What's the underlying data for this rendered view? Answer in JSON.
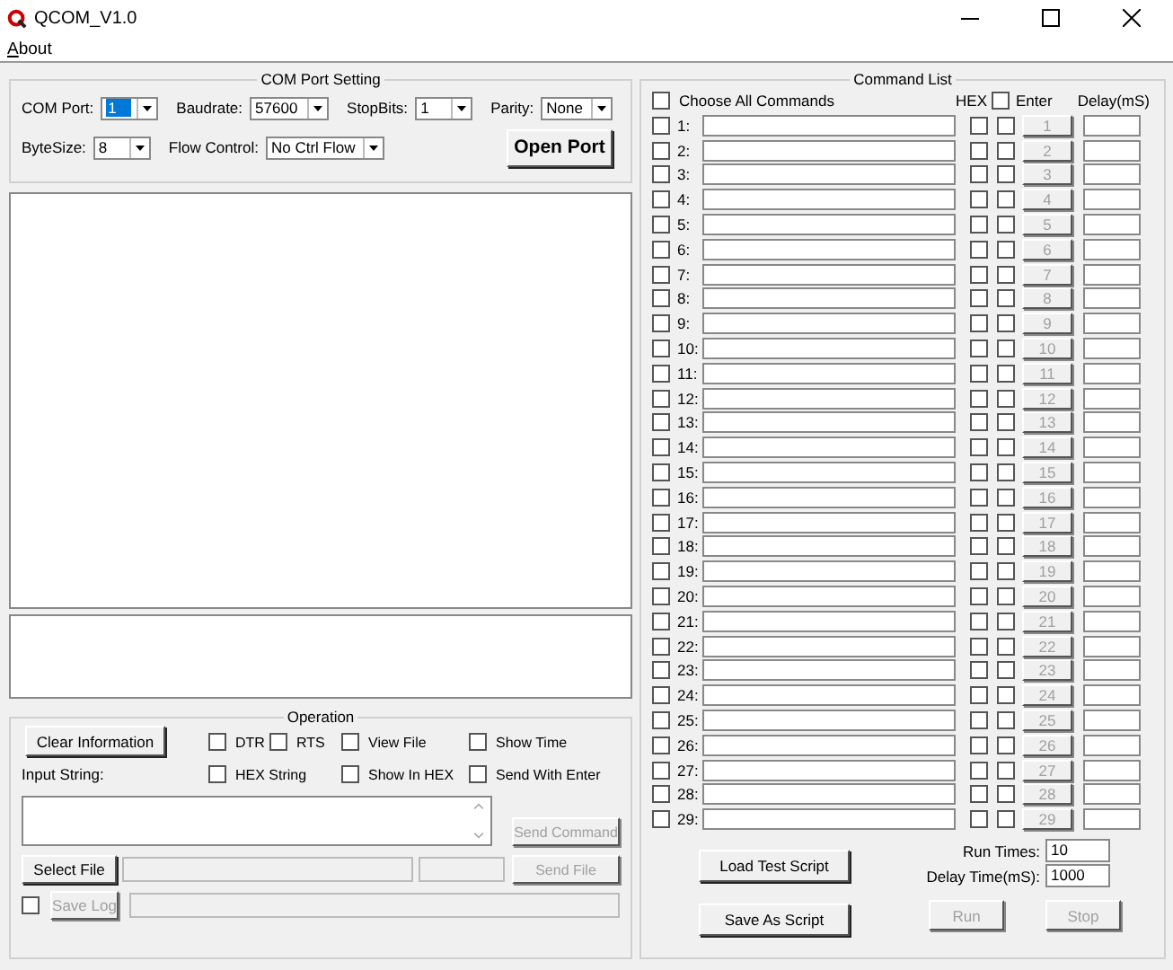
{
  "window": {
    "title": "QCOM_V1.0"
  },
  "menu": [
    {
      "label": "About"
    }
  ],
  "com_port_setting": {
    "title": "COM Port Setting",
    "fields": [
      {
        "label": "COM Port:",
        "value": "1",
        "focused": true
      },
      {
        "label": "Baudrate:",
        "value": "57600",
        "focused": false
      },
      {
        "label": "StopBits:",
        "value": "1",
        "focused": false
      },
      {
        "label": "Parity:",
        "value": "None",
        "focused": false
      },
      {
        "label": "ByteSize:",
        "value": "8",
        "focused": false
      },
      {
        "label": "Flow Control:",
        "value": "No Ctrl Flow",
        "focused": false
      }
    ],
    "open_port": "Open Port"
  },
  "operation": {
    "title": "Operation",
    "clear_button": "Clear Information",
    "checkboxes": [
      {
        "label": "DTR",
        "checked": false
      },
      {
        "label": "RTS",
        "checked": false
      },
      {
        "label": "View File",
        "checked": false
      },
      {
        "label": "Show Time",
        "checked": false
      },
      {
        "label": "HEX String",
        "checked": false
      },
      {
        "label": "Show In HEX",
        "checked": false
      },
      {
        "label": "Send With Enter",
        "checked": false
      }
    ],
    "input_label": "Input String:",
    "send_command": {
      "label": "Send Command",
      "disabled": true
    },
    "select_file": {
      "label": "Select File",
      "disabled": false
    },
    "send_file": {
      "label": "Send File",
      "disabled": true
    },
    "save_log": {
      "label": "Save Log",
      "checked": false,
      "disabled": true
    }
  },
  "command_list": {
    "title": "Command List",
    "choose_all": {
      "label": "Choose All Commands",
      "checked": false
    },
    "hex_header": "HEX",
    "enter_header": {
      "label": "Enter",
      "checked": false
    },
    "delay_header": "Delay(mS)",
    "rows": [
      {
        "label": "1:",
        "button": "1",
        "checked": false,
        "hex": false,
        "enter": false,
        "disabled": true
      },
      {
        "label": "2:",
        "button": "2",
        "checked": false,
        "hex": false,
        "enter": false,
        "disabled": true
      },
      {
        "label": "3:",
        "button": "3",
        "checked": false,
        "hex": false,
        "enter": false,
        "disabled": true
      },
      {
        "label": "4:",
        "button": "4",
        "checked": false,
        "hex": false,
        "enter": false,
        "disabled": true
      },
      {
        "label": "5:",
        "button": "5",
        "checked": false,
        "hex": false,
        "enter": false,
        "disabled": true
      },
      {
        "label": "6:",
        "button": "6",
        "checked": false,
        "hex": false,
        "enter": false,
        "disabled": true
      },
      {
        "label": "7:",
        "button": "7",
        "checked": false,
        "hex": false,
        "enter": false,
        "disabled": true
      },
      {
        "label": "8:",
        "button": "8",
        "checked": false,
        "hex": false,
        "enter": false,
        "disabled": true
      },
      {
        "label": "9:",
        "button": "9",
        "checked": false,
        "hex": false,
        "enter": false,
        "disabled": true
      },
      {
        "label": "10:",
        "button": "10",
        "checked": false,
        "hex": false,
        "enter": false,
        "disabled": true
      },
      {
        "label": "11:",
        "button": "11",
        "checked": false,
        "hex": false,
        "enter": false,
        "disabled": true
      },
      {
        "label": "12:",
        "button": "12",
        "checked": false,
        "hex": false,
        "enter": false,
        "disabled": true
      },
      {
        "label": "13:",
        "button": "13",
        "checked": false,
        "hex": false,
        "enter": false,
        "disabled": true
      },
      {
        "label": "14:",
        "button": "14",
        "checked": false,
        "hex": false,
        "enter": false,
        "disabled": true
      },
      {
        "label": "15:",
        "button": "15",
        "checked": false,
        "hex": false,
        "enter": false,
        "disabled": true
      },
      {
        "label": "16:",
        "button": "16",
        "checked": false,
        "hex": false,
        "enter": false,
        "disabled": true
      },
      {
        "label": "17:",
        "button": "17",
        "checked": false,
        "hex": false,
        "enter": false,
        "disabled": true
      },
      {
        "label": "18:",
        "button": "18",
        "checked": false,
        "hex": false,
        "enter": false,
        "disabled": true
      },
      {
        "label": "19:",
        "button": "19",
        "checked": false,
        "hex": false,
        "enter": false,
        "disabled": true
      },
      {
        "label": "20:",
        "button": "20",
        "checked": false,
        "hex": false,
        "enter": false,
        "disabled": true
      },
      {
        "label": "21:",
        "button": "21",
        "checked": false,
        "hex": false,
        "enter": false,
        "disabled": true
      },
      {
        "label": "22:",
        "button": "22",
        "checked": false,
        "hex": false,
        "enter": false,
        "disabled": true
      },
      {
        "label": "23:",
        "button": "23",
        "checked": false,
        "hex": false,
        "enter": false,
        "disabled": true
      },
      {
        "label": "24:",
        "button": "24",
        "checked": false,
        "hex": false,
        "enter": false,
        "disabled": true
      },
      {
        "label": "25:",
        "button": "25",
        "checked": false,
        "hex": false,
        "enter": false,
        "disabled": true
      },
      {
        "label": "26:",
        "button": "26",
        "checked": false,
        "hex": false,
        "enter": false,
        "disabled": true
      },
      {
        "label": "27:",
        "button": "27",
        "checked": false,
        "hex": false,
        "enter": false,
        "disabled": true
      },
      {
        "label": "28:",
        "button": "28",
        "checked": false,
        "hex": false,
        "enter": false,
        "disabled": true
      },
      {
        "label": "29:",
        "button": "29",
        "checked": false,
        "hex": false,
        "enter": false,
        "disabled": true
      }
    ],
    "load_script": "Load Test Script",
    "save_script": "Save As Script",
    "run_times": {
      "label": "Run Times:",
      "value": "10"
    },
    "delay_time": {
      "label": "Delay Time(mS):",
      "value": "1000"
    },
    "run": {
      "label": "Run",
      "disabled": true
    },
    "stop": {
      "label": "Stop",
      "disabled": true
    }
  }
}
